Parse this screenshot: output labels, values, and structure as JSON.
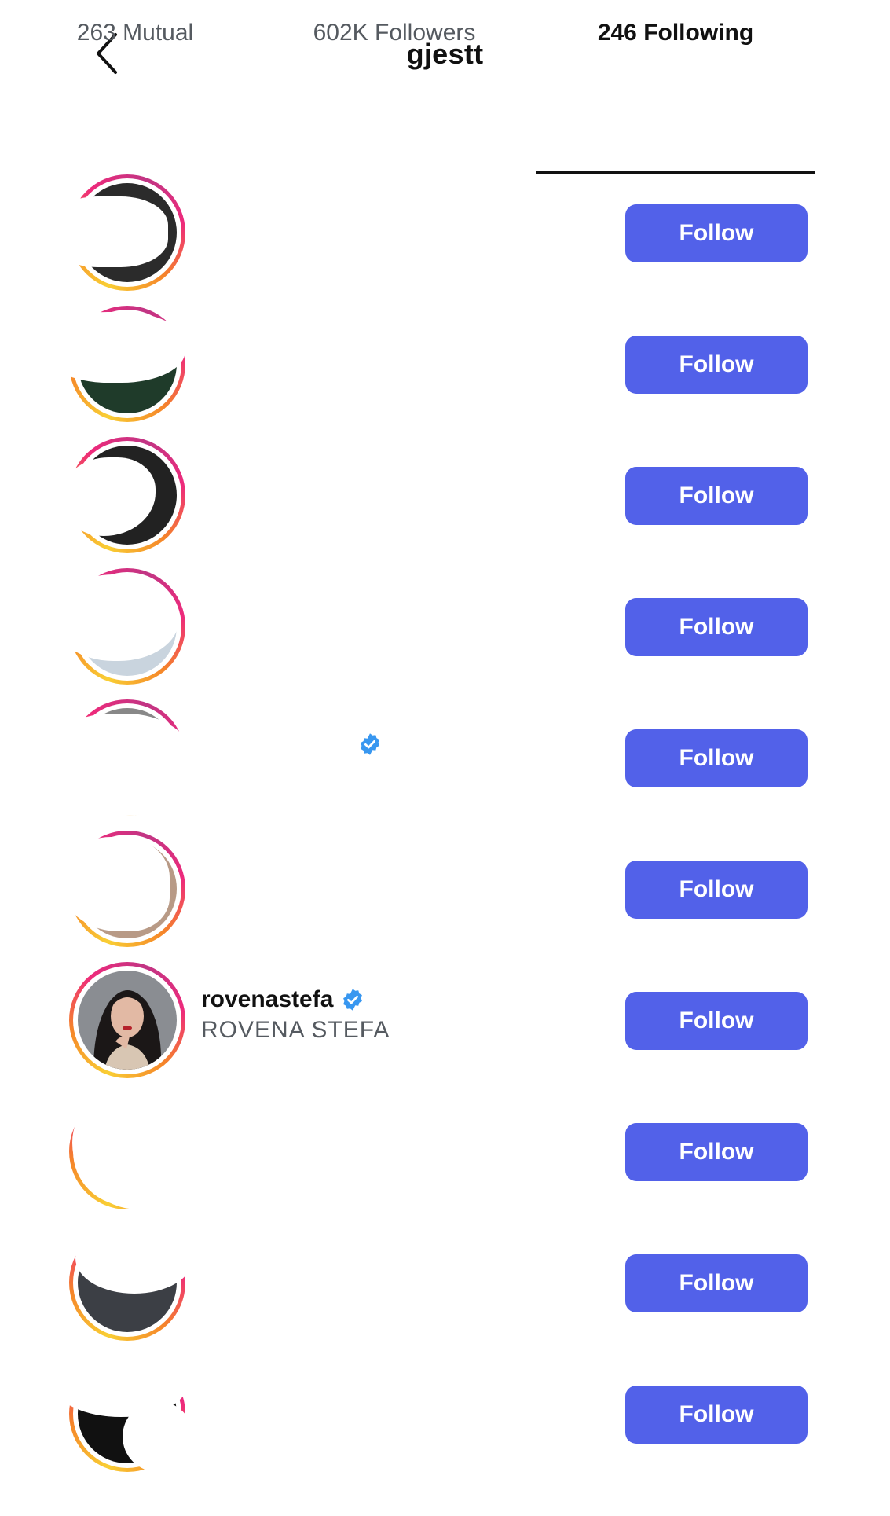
{
  "header": {
    "title": "gjestt"
  },
  "tabs": [
    {
      "label": "263 Mutual"
    },
    {
      "label": "602K Followers"
    },
    {
      "label": "246 Following"
    }
  ],
  "accent_color": "#5261e9",
  "follow_label": "Follow",
  "visible_account": {
    "username": "rovenastefa",
    "full_name": "ROVENA STEFA",
    "verified": true
  }
}
